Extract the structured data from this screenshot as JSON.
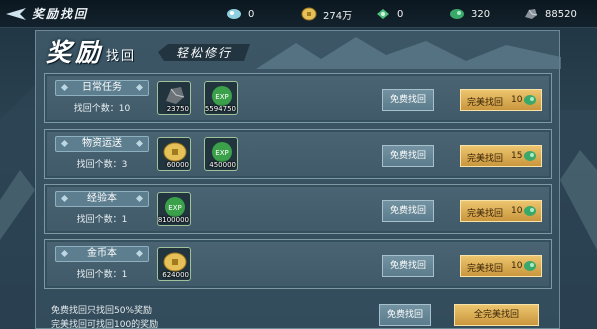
{
  "header": {
    "title": "奖励找回",
    "resources": [
      {
        "icon": "pearl-currency-icon",
        "value": "0"
      },
      {
        "icon": "gold-coin-icon",
        "value": "274万"
      },
      {
        "icon": "jade-currency-icon",
        "value": "0"
      },
      {
        "icon": "green-jade-icon",
        "value": "320"
      },
      {
        "icon": "silver-ore-icon",
        "value": "88520"
      }
    ]
  },
  "banner": {
    "big": "奖励",
    "small": "找回",
    "tag": "轻松修行"
  },
  "rows": [
    {
      "label": "日常任务",
      "count": "找回个数：10",
      "items": [
        {
          "icon": "ore-stone-icon",
          "qty": "23750"
        },
        {
          "icon": "exp-orb-icon",
          "qty": "5594750"
        }
      ],
      "free_label": "免费找回",
      "perfect_label": "完美找回",
      "perfect_cost": "10"
    },
    {
      "label": "物资运送",
      "count": "找回个数：3",
      "items": [
        {
          "icon": "gold-coin-icon",
          "qty": "60000"
        },
        {
          "icon": "exp-orb-icon",
          "qty": "450000"
        }
      ],
      "free_label": "免费找回",
      "perfect_label": "完美找回",
      "perfect_cost": "15"
    },
    {
      "label": "经验本",
      "count": "找回个数：1",
      "items": [
        {
          "icon": "exp-orb-icon",
          "qty": "8100000"
        }
      ],
      "free_label": "免费找回",
      "perfect_label": "完美找回",
      "perfect_cost": "10"
    },
    {
      "label": "金币本",
      "count": "找回个数：1",
      "items": [
        {
          "icon": "gold-coin-icon",
          "qty": "624000"
        }
      ],
      "free_label": "免费找回",
      "perfect_label": "完美找回",
      "perfect_cost": "10"
    }
  ],
  "footer": {
    "note1": "免费找回只找回50%奖励",
    "note2": "完美找回可找回100的奖励",
    "free_all_label": "免费找回",
    "perfect_all_label": "全完美找回"
  },
  "colors": {
    "panel": "#3c5666",
    "row": "#4a6473",
    "gold_button": "#ecc56e",
    "free_button": "#6a8a99"
  }
}
